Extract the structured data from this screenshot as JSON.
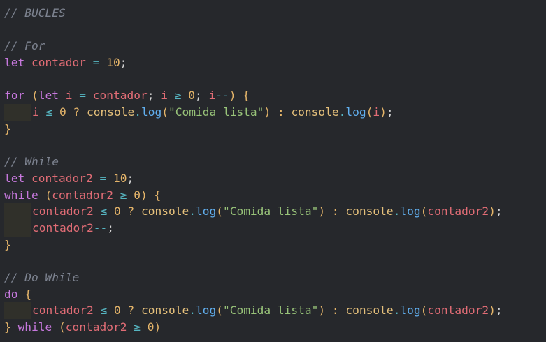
{
  "lines": [
    {
      "indent": 0,
      "tokens": [
        {
          "t": "// BUCLES",
          "c": "comment"
        }
      ]
    },
    {
      "indent": 0,
      "tokens": []
    },
    {
      "indent": 0,
      "tokens": [
        {
          "t": "// For",
          "c": "comment"
        }
      ]
    },
    {
      "indent": 0,
      "tokens": [
        {
          "t": "let",
          "c": "kw"
        },
        {
          "t": " "
        },
        {
          "t": "contador",
          "c": "var"
        },
        {
          "t": " "
        },
        {
          "t": "=",
          "c": "op"
        },
        {
          "t": " "
        },
        {
          "t": "10",
          "c": "num"
        },
        {
          "t": ";",
          "c": "punc"
        }
      ]
    },
    {
      "indent": 0,
      "tokens": []
    },
    {
      "indent": 0,
      "tokens": [
        {
          "t": "for",
          "c": "kw"
        },
        {
          "t": " "
        },
        {
          "t": "(",
          "c": "paren"
        },
        {
          "t": "let",
          "c": "kw"
        },
        {
          "t": " "
        },
        {
          "t": "i",
          "c": "var"
        },
        {
          "t": " "
        },
        {
          "t": "=",
          "c": "op"
        },
        {
          "t": " "
        },
        {
          "t": "contador",
          "c": "var"
        },
        {
          "t": ";",
          "c": "punc"
        },
        {
          "t": " "
        },
        {
          "t": "i",
          "c": "var"
        },
        {
          "t": " "
        },
        {
          "t": "≥",
          "c": "op"
        },
        {
          "t": " "
        },
        {
          "t": "0",
          "c": "num"
        },
        {
          "t": ";",
          "c": "punc"
        },
        {
          "t": " "
        },
        {
          "t": "i",
          "c": "var"
        },
        {
          "t": "--",
          "c": "op"
        },
        {
          "t": ")",
          "c": "paren"
        },
        {
          "t": " "
        },
        {
          "t": "{",
          "c": "brace"
        }
      ]
    },
    {
      "indent": 1,
      "tokens": [
        {
          "t": "i",
          "c": "var"
        },
        {
          "t": " "
        },
        {
          "t": "≤",
          "c": "op"
        },
        {
          "t": " "
        },
        {
          "t": "0",
          "c": "num"
        },
        {
          "t": " "
        },
        {
          "t": "?",
          "c": "tern"
        },
        {
          "t": " "
        },
        {
          "t": "console",
          "c": "obj"
        },
        {
          "t": ".",
          "c": "dot"
        },
        {
          "t": "log",
          "c": "fn"
        },
        {
          "t": "(",
          "c": "paren"
        },
        {
          "t": "\"Comida lista\"",
          "c": "str"
        },
        {
          "t": ")",
          "c": "paren"
        },
        {
          "t": " "
        },
        {
          "t": ":",
          "c": "tern"
        },
        {
          "t": " "
        },
        {
          "t": "console",
          "c": "obj"
        },
        {
          "t": ".",
          "c": "dot"
        },
        {
          "t": "log",
          "c": "fn"
        },
        {
          "t": "(",
          "c": "paren"
        },
        {
          "t": "i",
          "c": "var"
        },
        {
          "t": ")",
          "c": "paren"
        },
        {
          "t": ";",
          "c": "punc"
        }
      ]
    },
    {
      "indent": 0,
      "tokens": [
        {
          "t": "}",
          "c": "brace"
        }
      ]
    },
    {
      "indent": 0,
      "tokens": []
    },
    {
      "indent": 0,
      "tokens": [
        {
          "t": "// While",
          "c": "comment"
        }
      ]
    },
    {
      "indent": 0,
      "tokens": [
        {
          "t": "let",
          "c": "kw"
        },
        {
          "t": " "
        },
        {
          "t": "contador2",
          "c": "var"
        },
        {
          "t": " "
        },
        {
          "t": "=",
          "c": "op"
        },
        {
          "t": " "
        },
        {
          "t": "10",
          "c": "num"
        },
        {
          "t": ";",
          "c": "punc"
        }
      ]
    },
    {
      "indent": 0,
      "tokens": [
        {
          "t": "while",
          "c": "kw"
        },
        {
          "t": " "
        },
        {
          "t": "(",
          "c": "paren"
        },
        {
          "t": "contador2",
          "c": "var"
        },
        {
          "t": " "
        },
        {
          "t": "≥",
          "c": "op"
        },
        {
          "t": " "
        },
        {
          "t": "0",
          "c": "num"
        },
        {
          "t": ")",
          "c": "paren"
        },
        {
          "t": " "
        },
        {
          "t": "{",
          "c": "brace"
        }
      ]
    },
    {
      "indent": 1,
      "tokens": [
        {
          "t": "contador2",
          "c": "var"
        },
        {
          "t": " "
        },
        {
          "t": "≤",
          "c": "op"
        },
        {
          "t": " "
        },
        {
          "t": "0",
          "c": "num"
        },
        {
          "t": " "
        },
        {
          "t": "?",
          "c": "tern"
        },
        {
          "t": " "
        },
        {
          "t": "console",
          "c": "obj"
        },
        {
          "t": ".",
          "c": "dot"
        },
        {
          "t": "log",
          "c": "fn"
        },
        {
          "t": "(",
          "c": "paren"
        },
        {
          "t": "\"Comida lista\"",
          "c": "str"
        },
        {
          "t": ")",
          "c": "paren"
        },
        {
          "t": " "
        },
        {
          "t": ":",
          "c": "tern"
        },
        {
          "t": " "
        },
        {
          "t": "console",
          "c": "obj"
        },
        {
          "t": ".",
          "c": "dot"
        },
        {
          "t": "log",
          "c": "fn"
        },
        {
          "t": "(",
          "c": "paren"
        },
        {
          "t": "contador2",
          "c": "var"
        },
        {
          "t": ")",
          "c": "paren"
        },
        {
          "t": ";",
          "c": "punc"
        }
      ]
    },
    {
      "indent": 1,
      "tokens": [
        {
          "t": "contador2",
          "c": "var"
        },
        {
          "t": "--",
          "c": "op"
        },
        {
          "t": ";",
          "c": "punc"
        }
      ]
    },
    {
      "indent": 0,
      "tokens": [
        {
          "t": "}",
          "c": "brace"
        }
      ]
    },
    {
      "indent": 0,
      "tokens": []
    },
    {
      "indent": 0,
      "tokens": [
        {
          "t": "// Do While",
          "c": "comment"
        }
      ]
    },
    {
      "indent": 0,
      "tokens": [
        {
          "t": "do",
          "c": "kw"
        },
        {
          "t": " "
        },
        {
          "t": "{",
          "c": "brace"
        }
      ]
    },
    {
      "indent": 1,
      "tokens": [
        {
          "t": "contador2",
          "c": "var"
        },
        {
          "t": " "
        },
        {
          "t": "≤",
          "c": "op"
        },
        {
          "t": " "
        },
        {
          "t": "0",
          "c": "num"
        },
        {
          "t": " "
        },
        {
          "t": "?",
          "c": "tern"
        },
        {
          "t": " "
        },
        {
          "t": "console",
          "c": "obj"
        },
        {
          "t": ".",
          "c": "dot"
        },
        {
          "t": "log",
          "c": "fn"
        },
        {
          "t": "(",
          "c": "paren"
        },
        {
          "t": "\"Comida lista\"",
          "c": "str"
        },
        {
          "t": ")",
          "c": "paren"
        },
        {
          "t": " "
        },
        {
          "t": ":",
          "c": "tern"
        },
        {
          "t": " "
        },
        {
          "t": "console",
          "c": "obj"
        },
        {
          "t": ".",
          "c": "dot"
        },
        {
          "t": "log",
          "c": "fn"
        },
        {
          "t": "(",
          "c": "paren"
        },
        {
          "t": "contador2",
          "c": "var"
        },
        {
          "t": ")",
          "c": "paren"
        },
        {
          "t": ";",
          "c": "punc"
        }
      ]
    },
    {
      "indent": 0,
      "tokens": [
        {
          "t": "}",
          "c": "brace"
        },
        {
          "t": " "
        },
        {
          "t": "while",
          "c": "kw"
        },
        {
          "t": " "
        },
        {
          "t": "(",
          "c": "paren"
        },
        {
          "t": "contador2",
          "c": "var"
        },
        {
          "t": " "
        },
        {
          "t": "≥",
          "c": "op"
        },
        {
          "t": " "
        },
        {
          "t": "0",
          "c": "num"
        },
        {
          "t": ")",
          "c": "paren"
        }
      ]
    }
  ],
  "colors": {
    "background": "#26282c",
    "keyword": "#c678dd",
    "variable": "#e06c75",
    "number": "#e5b56a",
    "operator": "#56b6c2",
    "function": "#61afef",
    "string": "#98c379",
    "object": "#e5c07b",
    "comment": "#7d8390",
    "indent_guide": "#30302a"
  }
}
